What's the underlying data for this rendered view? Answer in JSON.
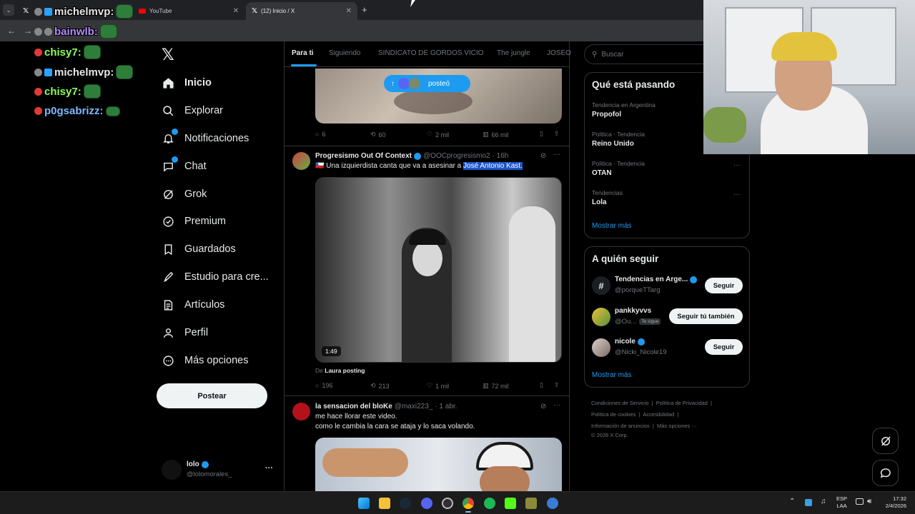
{
  "browser": {
    "tabs": [
      {
        "title": "",
        "active": false
      },
      {
        "title": "YouTube",
        "active": false
      },
      {
        "title": "(12) Inicio / X",
        "active": true
      }
    ],
    "new_tab": "+"
  },
  "chat_overlay": [
    {
      "user": "michelmvp:",
      "color": "#e6e6e6"
    },
    {
      "user": "bainwlb:",
      "color": "#b58cff"
    },
    {
      "user": "chisy7:",
      "color": "#8cff5a"
    },
    {
      "user": "michelmvp:",
      "color": "#e6e6e6"
    },
    {
      "user": "chisy7:",
      "color": "#8cff5a"
    },
    {
      "user": "p0gsabrizz:",
      "color": "#7fb8ff"
    }
  ],
  "sidebar": {
    "logo": "𝕏",
    "items": [
      {
        "label": "Inicio",
        "icon": "home-icon"
      },
      {
        "label": "Explorar",
        "icon": "search-icon"
      },
      {
        "label": "Notificaciones",
        "icon": "bell-icon"
      },
      {
        "label": "Chat",
        "icon": "chat-icon"
      },
      {
        "label": "Grok",
        "icon": "grok-icon"
      },
      {
        "label": "Premium",
        "icon": "verified-icon"
      },
      {
        "label": "Guardados",
        "icon": "bookmark-icon"
      },
      {
        "label": "Estudio para cre...",
        "icon": "rocket-icon"
      },
      {
        "label": "Artículos",
        "icon": "article-icon"
      },
      {
        "label": "Perfil",
        "icon": "person-icon"
      },
      {
        "label": "Más opciones",
        "icon": "more-icon"
      }
    ],
    "post_button": "Postear",
    "account": {
      "name": "lolo",
      "handle": "@lolomorales_",
      "more": "···"
    }
  },
  "feed": {
    "tabs": [
      "Para ti",
      "Siguiendo",
      "SINDICATO DE GORDOS VICIO",
      "The jungle",
      "JOSEO"
    ],
    "posted_pill": "posteó",
    "post1_stats": {
      "replies": "6",
      "reposts": "60",
      "likes": "2 mil",
      "views": "66 mil"
    },
    "post2": {
      "author": "Progresismo Out Of Context",
      "handle": "@OOCprogresismo2",
      "time": "· 16h",
      "flag": "🇨🇱",
      "text": "Una izquierdista canta que va a asesinar a",
      "highlight": "José Antonio Kast.",
      "duration": "1:49",
      "from_prefix": "De",
      "from_name": "Laura posting",
      "stats": {
        "replies": "196",
        "reposts": "213",
        "likes": "1 mil",
        "views": "72 mil"
      }
    },
    "post3": {
      "author": "la sensacion del bloKe",
      "handle": "@maxi223_",
      "time": "· 1 abr.",
      "line1": "me hace llorar este video.",
      "line2": "como le cambia la cara se ataja y lo saca volando."
    }
  },
  "right": {
    "search_placeholder": "Buscar",
    "trends_title": "Qué está pasando",
    "trends": [
      {
        "sub": "Tendencia en Argentina",
        "name": "Propofol"
      },
      {
        "sub": "Política · Tendencia",
        "name": "Reino Unido"
      },
      {
        "sub": "Política · Tendencia",
        "name": "OTAN"
      },
      {
        "sub": "Tendencias",
        "name": "Lola"
      }
    ],
    "show_more": "Mostrar más",
    "follow_title": "A quién seguir",
    "follow": [
      {
        "name": "Tendencias en Arge...",
        "handle": "@porqueTTarg",
        "button": "Seguir",
        "follows_you": ""
      },
      {
        "name": "pankkyvvs",
        "handle": "@Ou...",
        "button": "Seguir tú también",
        "follows_you": "Te sigue"
      },
      {
        "name": "nicole",
        "handle": "@Nicki_Nicole19",
        "button": "Seguir",
        "follows_you": ""
      }
    ],
    "footer": {
      "l1a": "Condiciones de Servicio",
      "l1b": "Política de Privacidad",
      "l2a": "Política de cookies",
      "l2b": "Accesibilidad",
      "l3a": "Información de anuncios",
      "l3b": "Más opciones ···",
      "copy": "© 2026 X Corp."
    }
  },
  "taskbar": {
    "lang1": "ESP",
    "lang2": "LAA",
    "time": "17:32",
    "date": "2/4/2026"
  },
  "colors": {
    "accent": "#1d9bf0",
    "bg": "#000000",
    "border": "#2f3336",
    "muted": "#71767b"
  }
}
